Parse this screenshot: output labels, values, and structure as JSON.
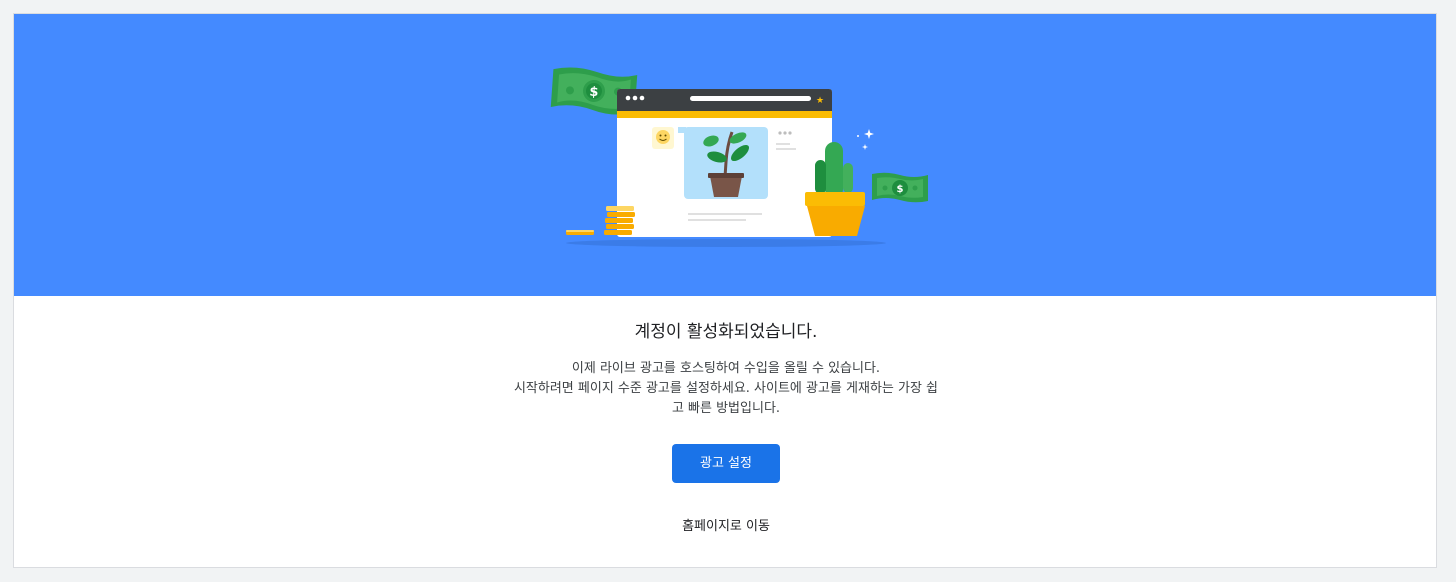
{
  "dialog": {
    "title": "계정이 활성화되었습니다.",
    "description_lines": [
      "이제 라이브 광고를 호스팅하여 수입을 올릴 수 있습니다.",
      "시작하려면 페이지 수준 광고를 설정하세요. 사이트에 광고를 게재하는 가장 쉽",
      "고 빠른 방법입니다."
    ],
    "primary_button_label": "광고 설정",
    "secondary_link_label": "홈페이지로 이동"
  },
  "hero": {
    "illustration_icons": [
      "money-bill-icon",
      "browser-window-icon",
      "plant-icon",
      "cactus-icon",
      "coin-stack-icon",
      "sparkle-icon",
      "smiley-icon"
    ]
  },
  "colors": {
    "hero_background": "#448aff",
    "primary_button": "#1a73e8",
    "money_green": "#2e9e4b",
    "pot_yellow": "#fbbc04"
  }
}
